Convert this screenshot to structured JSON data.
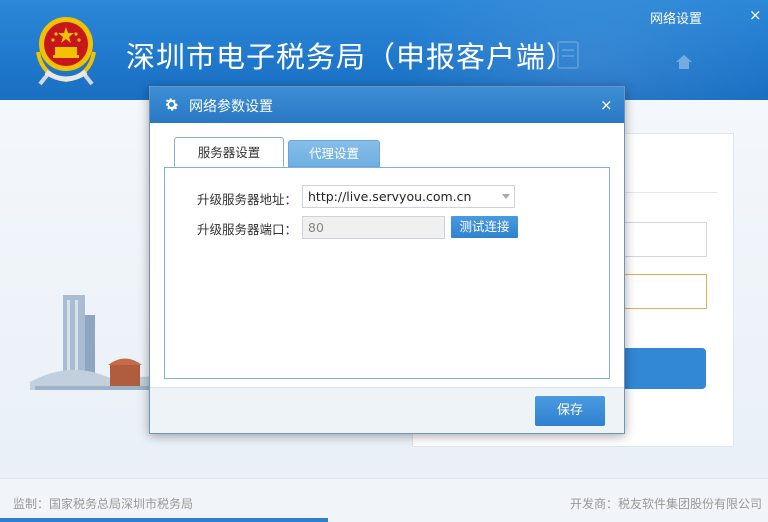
{
  "app": {
    "title": "深圳市电子税务局（申报客户端）",
    "network_settings_link": "网络设置",
    "close_glyph": "×"
  },
  "dialog": {
    "title": "网络参数设置",
    "close_glyph": "×",
    "tabs": [
      {
        "label": "服务器设置",
        "active": true
      },
      {
        "label": "代理设置",
        "active": false
      }
    ],
    "fields": {
      "address_label": "升级服务器地址：",
      "address_value": "http://live.servyou.com.cn",
      "port_label": "升级服务器端口：",
      "port_value": "80"
    },
    "test_button": "测试连接",
    "save_button": "保存"
  },
  "footer": {
    "left": "监制：国家税务总局深圳市税务局",
    "right": "开发商：税友软件集团股份有限公司"
  },
  "colors": {
    "header_blue": "#1f78cc",
    "button_blue": "#2f82cf",
    "tab_inactive": "#6fb0e2",
    "emblem_red": "#c8161d",
    "emblem_gold": "#f2c200"
  },
  "icons": [
    "national-emblem-icon",
    "gear-icon",
    "close-icon",
    "home-icon",
    "chevron-down-icon"
  ]
}
